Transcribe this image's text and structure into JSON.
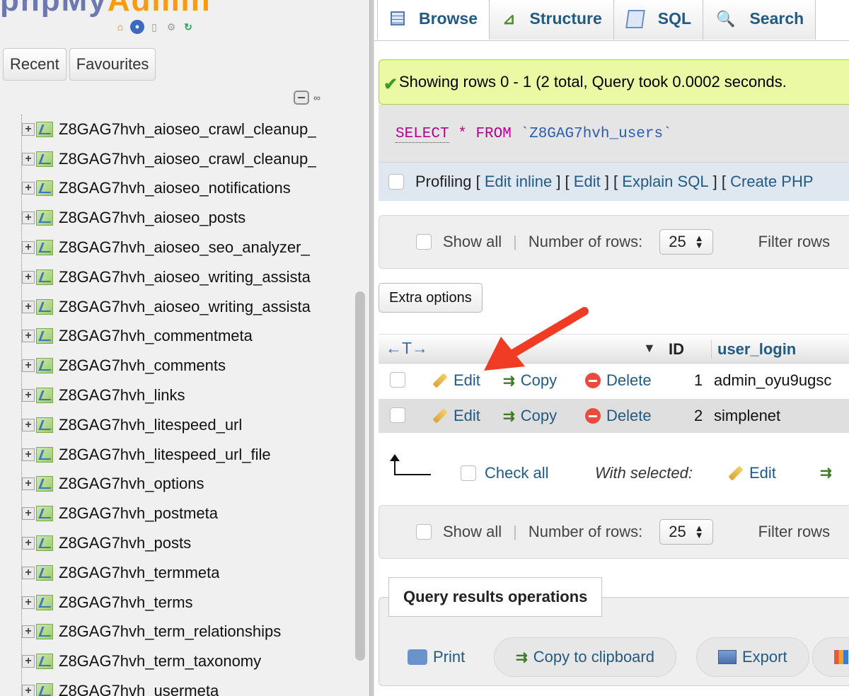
{
  "left_panel": {
    "logo_text_1": "phpMy",
    "logo_text_2": "Admin",
    "nav_icons": [
      "home-icon",
      "database-icon",
      "document-icon",
      "gear-icon",
      "reload-icon"
    ],
    "tabs": [
      "Recent",
      "Favourites"
    ],
    "tables": [
      "Z8GAG7hvh_aioseo_crawl_cleanup_",
      "Z8GAG7hvh_aioseo_crawl_cleanup_",
      "Z8GAG7hvh_aioseo_notifications",
      "Z8GAG7hvh_aioseo_posts",
      "Z8GAG7hvh_aioseo_seo_analyzer_",
      "Z8GAG7hvh_aioseo_writing_assista",
      "Z8GAG7hvh_aioseo_writing_assista",
      "Z8GAG7hvh_commentmeta",
      "Z8GAG7hvh_comments",
      "Z8GAG7hvh_links",
      "Z8GAG7hvh_litespeed_url",
      "Z8GAG7hvh_litespeed_url_file",
      "Z8GAG7hvh_options",
      "Z8GAG7hvh_postmeta",
      "Z8GAG7hvh_posts",
      "Z8GAG7hvh_termmeta",
      "Z8GAG7hvh_terms",
      "Z8GAG7hvh_term_relationships",
      "Z8GAG7hvh_term_taxonomy",
      "Z8GAG7hvh_usermeta"
    ]
  },
  "top_tabs": [
    {
      "label": "Browse",
      "icon": "browse-icon"
    },
    {
      "label": "Structure",
      "icon": "structure-icon"
    },
    {
      "label": "SQL",
      "icon": "sql-icon"
    },
    {
      "label": "Search",
      "icon": "search-icon"
    }
  ],
  "success_message": "Showing rows 0 - 1 (2 total, Query took 0.0002 seconds.",
  "sql_query": {
    "kw_select": "SELECT",
    "star": "*",
    "kw_from": "FROM",
    "table": "`Z8GAG7hvh_users`"
  },
  "profiling": {
    "label": "Profiling",
    "links": [
      "Edit inline",
      "Edit",
      "Explain SQL",
      "Create PHP"
    ]
  },
  "nav_controls": {
    "show_all": "Show all",
    "rows_label": "Number of rows:",
    "rows_value": "25",
    "filter_label": "Filter rows"
  },
  "extra_options": "Extra options",
  "results_table": {
    "columns": [
      "ID",
      "user_login"
    ],
    "actions": {
      "edit": "Edit",
      "copy": "Copy",
      "delete": "Delete"
    },
    "rows": [
      {
        "id": "1",
        "user_login": "admin_oyu9ugsc"
      },
      {
        "id": "2",
        "user_login": "simplenet"
      }
    ]
  },
  "with_selected": {
    "check_all": "Check all",
    "label": "With selected:",
    "edit": "Edit"
  },
  "query_ops": {
    "title": "Query results operations",
    "print": "Print",
    "copy_clipboard": "Copy to clipboard",
    "export": "Export"
  },
  "colors": {
    "link": "#235a81",
    "success_bg": "#ebf8a4",
    "annotation_arrow": "#f03c24"
  }
}
